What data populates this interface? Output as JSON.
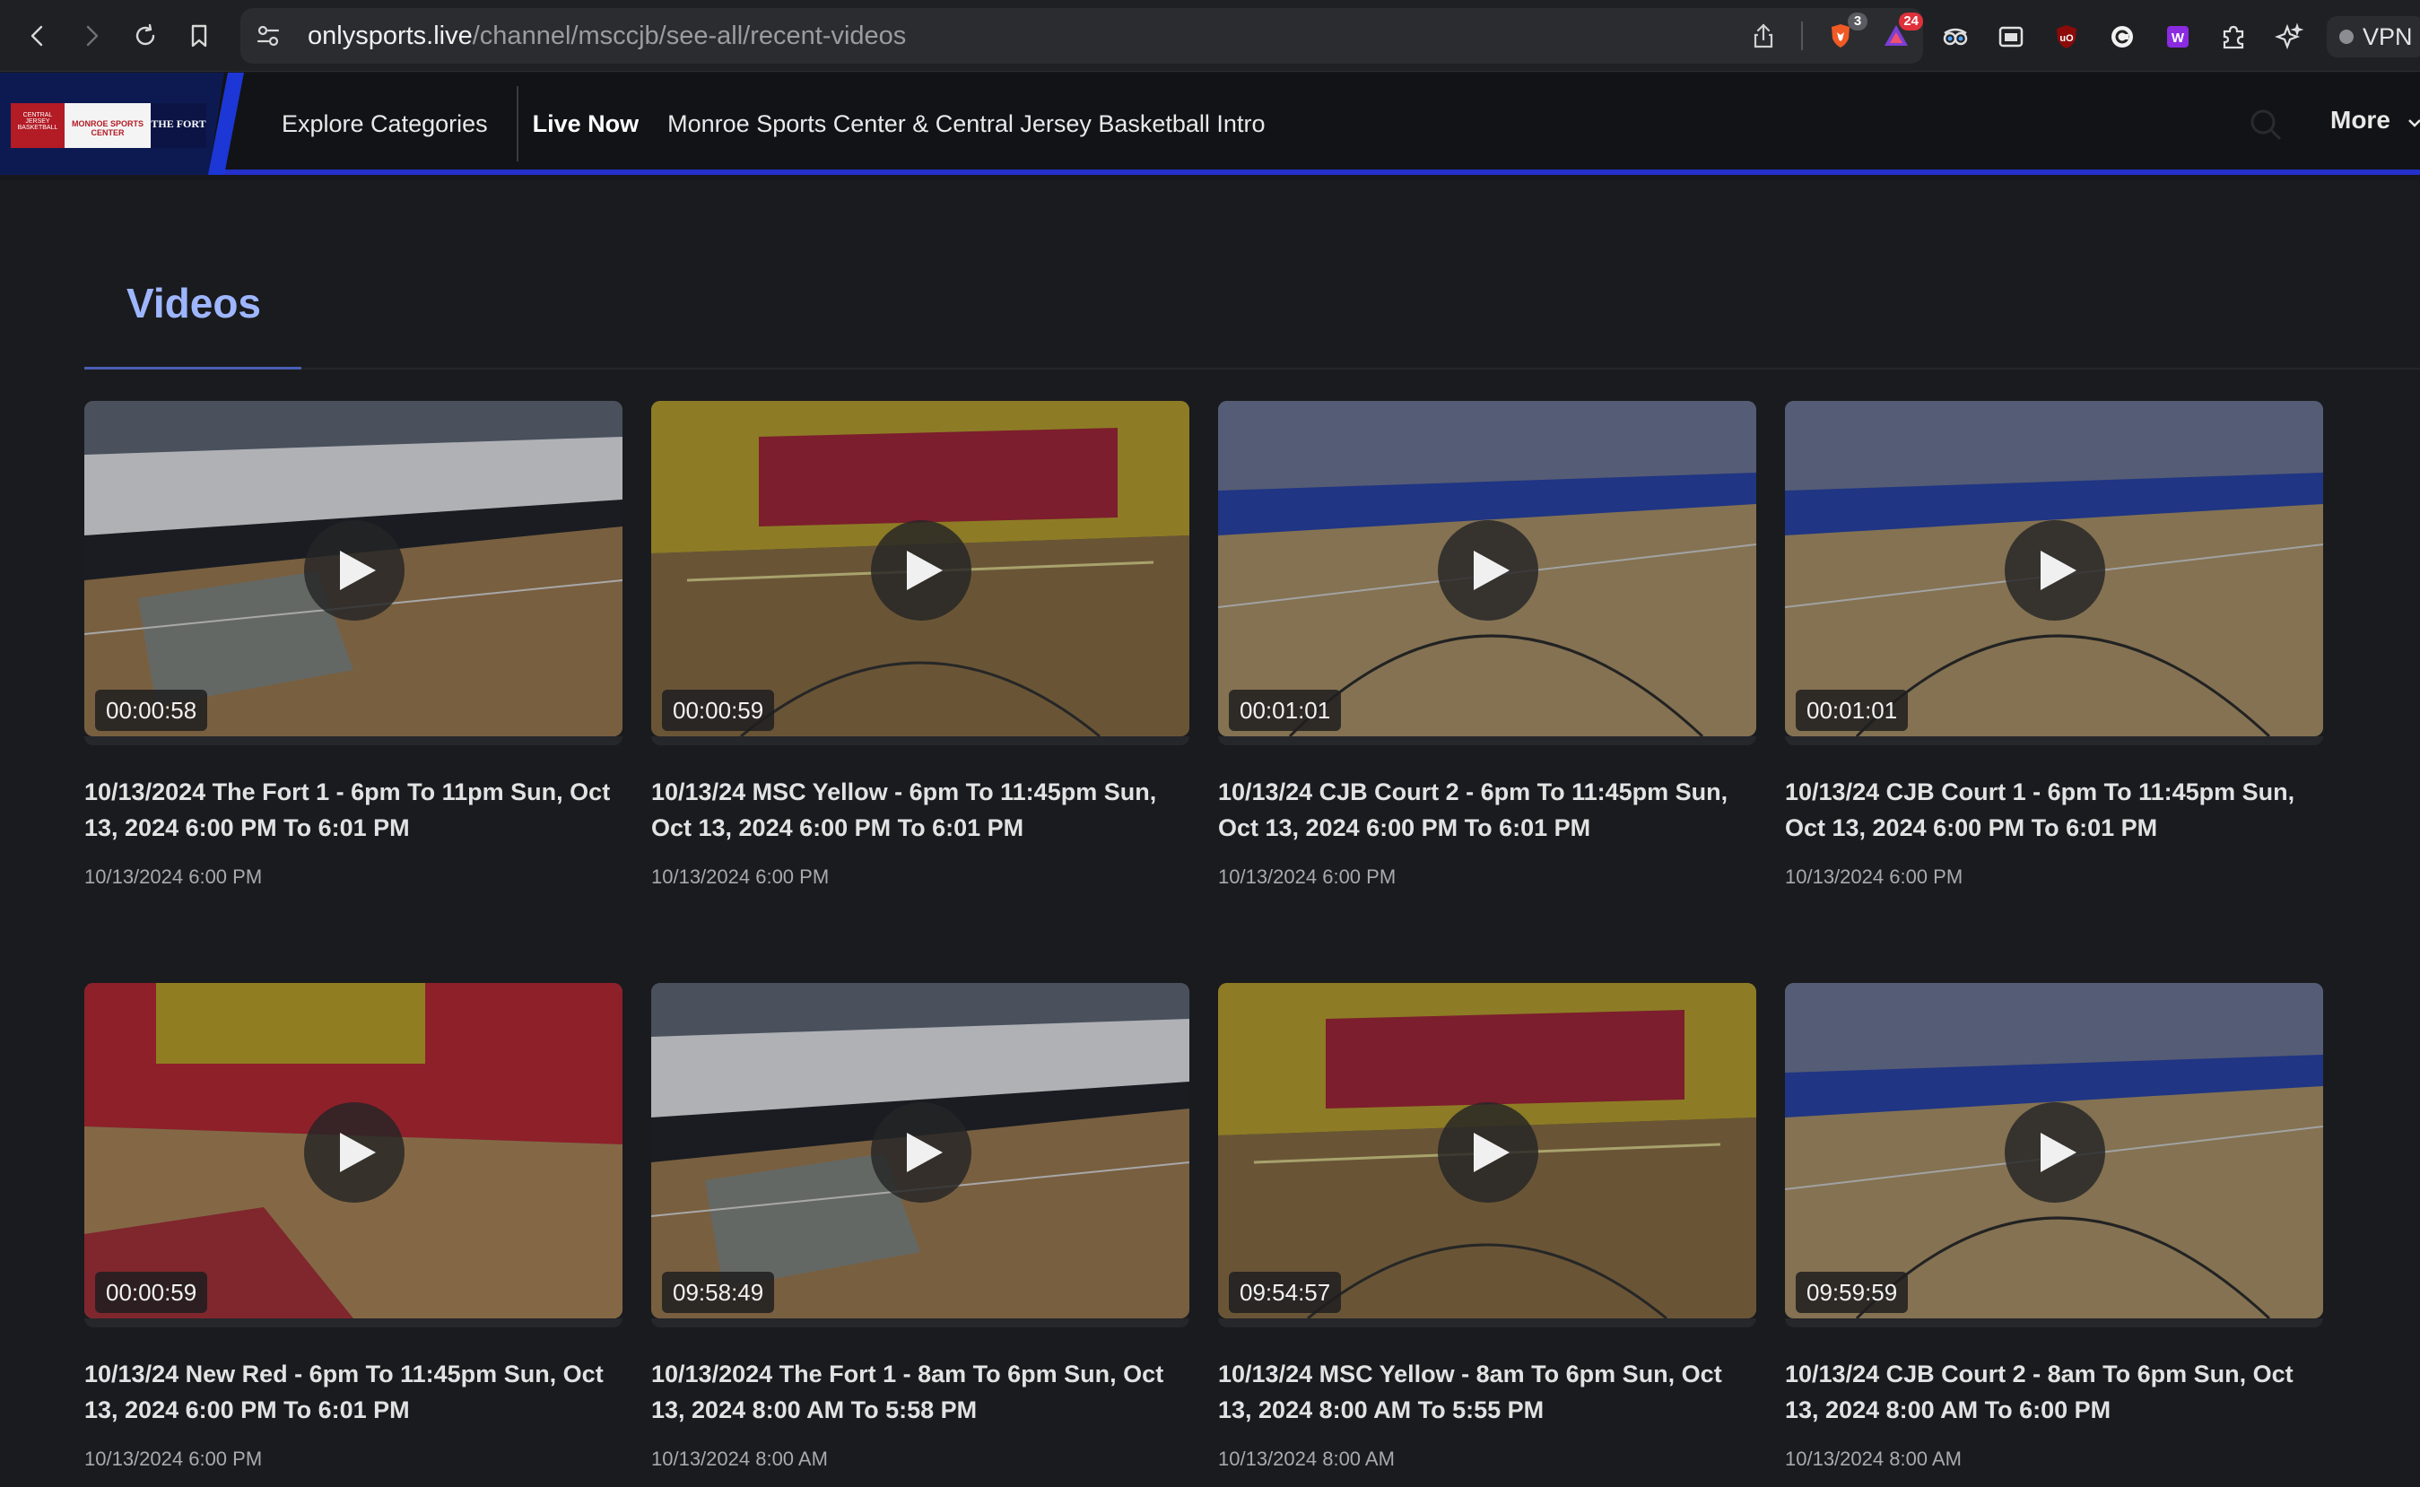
{
  "browser": {
    "url_domain": "onlysports.live",
    "url_path": "/channel/msccjb/see-all/recent-videos",
    "brave_badge": "3",
    "alert_badge": "24",
    "vpn_label": "VPN",
    "icons": [
      "back-icon",
      "forward-icon",
      "reload-icon",
      "bookmark-icon",
      "site-settings-icon",
      "share-icon",
      "brave-shields-icon",
      "brave-rewards-icon",
      "ext-glasses-icon",
      "ext-window-icon",
      "ublock-icon",
      "ext-c-icon",
      "ext-w-icon",
      "extensions-puzzle-icon",
      "leo-ai-icon"
    ]
  },
  "site": {
    "logo_texts": [
      "CENTRAL JERSEY BASKETBALL",
      "MONROE SPORTS CENTER",
      "THE FORT"
    ],
    "nav": {
      "explore": "Explore Categories",
      "live": "Live Now",
      "intro": "Monroe Sports Center & Central Jersey Basketball Intro",
      "more": "More"
    },
    "accent_color": "#2330c9"
  },
  "section": {
    "title": "Videos"
  },
  "videos": [
    {
      "duration": "00:00:58",
      "title": "10/13/2024 The Fort 1 - 6pm To 11pm Sun, Oct 13, 2024 6:00 PM To 6:01 PM",
      "date": "10/13/2024 6:00 PM",
      "scene": "fort"
    },
    {
      "duration": "00:00:59",
      "title": "10/13/24 MSC Yellow - 6pm To 11:45pm Sun, Oct 13, 2024 6:00 PM To 6:01 PM",
      "date": "10/13/2024 6:00 PM",
      "scene": "yellow"
    },
    {
      "duration": "00:01:01",
      "title": "10/13/24 CJB Court 2 - 6pm To 11:45pm Sun, Oct 13, 2024 6:00 PM To 6:01 PM",
      "date": "10/13/2024 6:00 PM",
      "scene": "blue"
    },
    {
      "duration": "00:01:01",
      "title": "10/13/24 CJB Court 1 - 6pm To 11:45pm Sun, Oct 13, 2024 6:00 PM To 6:01 PM",
      "date": "10/13/2024 6:00 PM",
      "scene": "blue"
    },
    {
      "duration": "00:00:59",
      "title": "10/13/24 New Red - 6pm To 11:45pm Sun, Oct 13, 2024 6:00 PM To 6:01 PM",
      "date": "10/13/2024 6:00 PM",
      "scene": "red"
    },
    {
      "duration": "09:58:49",
      "title": "10/13/2024 The Fort 1 - 8am To 6pm Sun, Oct 13, 2024 8:00 AM To 5:58 PM",
      "date": "10/13/2024 8:00 AM",
      "scene": "fort"
    },
    {
      "duration": "09:54:57",
      "title": "10/13/24 MSC Yellow - 8am To 6pm Sun, Oct 13, 2024 8:00 AM To 5:55 PM",
      "date": "10/13/2024 8:00 AM",
      "scene": "yellow"
    },
    {
      "duration": "09:59:59",
      "title": "10/13/24 CJB Court 2 - 8am To 6pm Sun, Oct 13, 2024 8:00 AM To 6:00 PM",
      "date": "10/13/2024 8:00 AM",
      "scene": "blue"
    }
  ]
}
